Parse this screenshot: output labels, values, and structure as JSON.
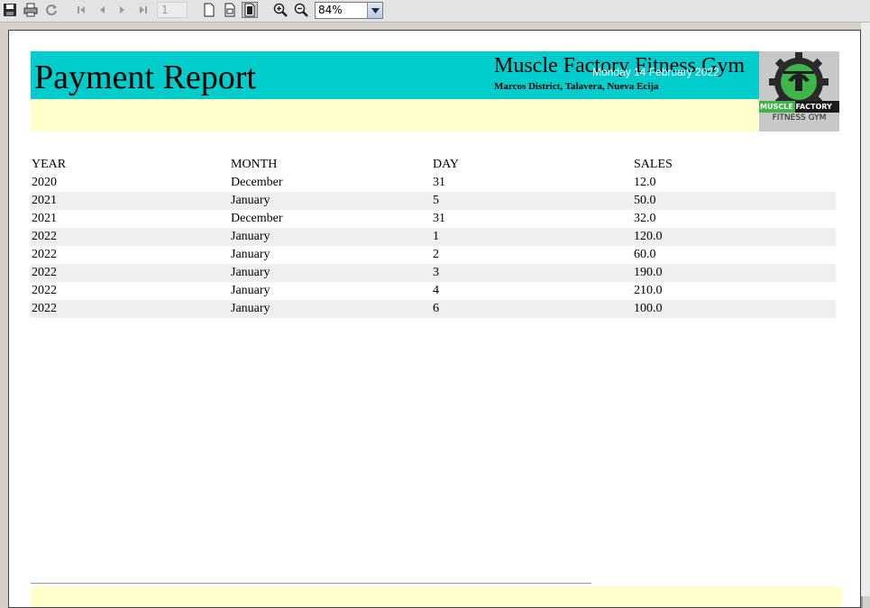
{
  "toolbar": {
    "buttons": [
      {
        "name": "save-icon"
      },
      {
        "name": "print-icon"
      },
      {
        "name": "refresh-icon"
      },
      {
        "name": "first-page-icon"
      },
      {
        "name": "previous-page-icon"
      },
      {
        "name": "next-page-icon"
      },
      {
        "name": "last-page-icon"
      },
      {
        "name": "actual-size-icon"
      },
      {
        "name": "fit-width-icon"
      },
      {
        "name": "fit-page-icon"
      },
      {
        "name": "zoom-in-icon"
      },
      {
        "name": "zoom-out-icon"
      }
    ],
    "page_number": "1",
    "zoom_value": "84%"
  },
  "report": {
    "title": "Payment Report",
    "company": "Muscle Factory Fitness Gym",
    "address": "Marcos District, Talavera, Nueva Ecija",
    "date": "Monday 14 February 2022",
    "logo": {
      "text_top": "MUSCLE FACTORY",
      "text_bottom": "FITNESS GYM"
    },
    "colors": {
      "header_band": "#00cccc",
      "header_subband": "#ffffcc",
      "row_alt": "#efefef"
    }
  },
  "table": {
    "columns": [
      "YEAR",
      "MONTH",
      "DAY",
      "SALES"
    ],
    "rows": [
      [
        "2020",
        "December",
        "31",
        "12.0"
      ],
      [
        "2021",
        "January",
        "5",
        "50.0"
      ],
      [
        "2021",
        "December",
        "31",
        "32.0"
      ],
      [
        "2022",
        "January",
        "1",
        "120.0"
      ],
      [
        "2022",
        "January",
        "2",
        "60.0"
      ],
      [
        "2022",
        "January",
        "3",
        "190.0"
      ],
      [
        "2022",
        "January",
        "4",
        "210.0"
      ],
      [
        "2022",
        "January",
        "6",
        "100.0"
      ]
    ]
  }
}
